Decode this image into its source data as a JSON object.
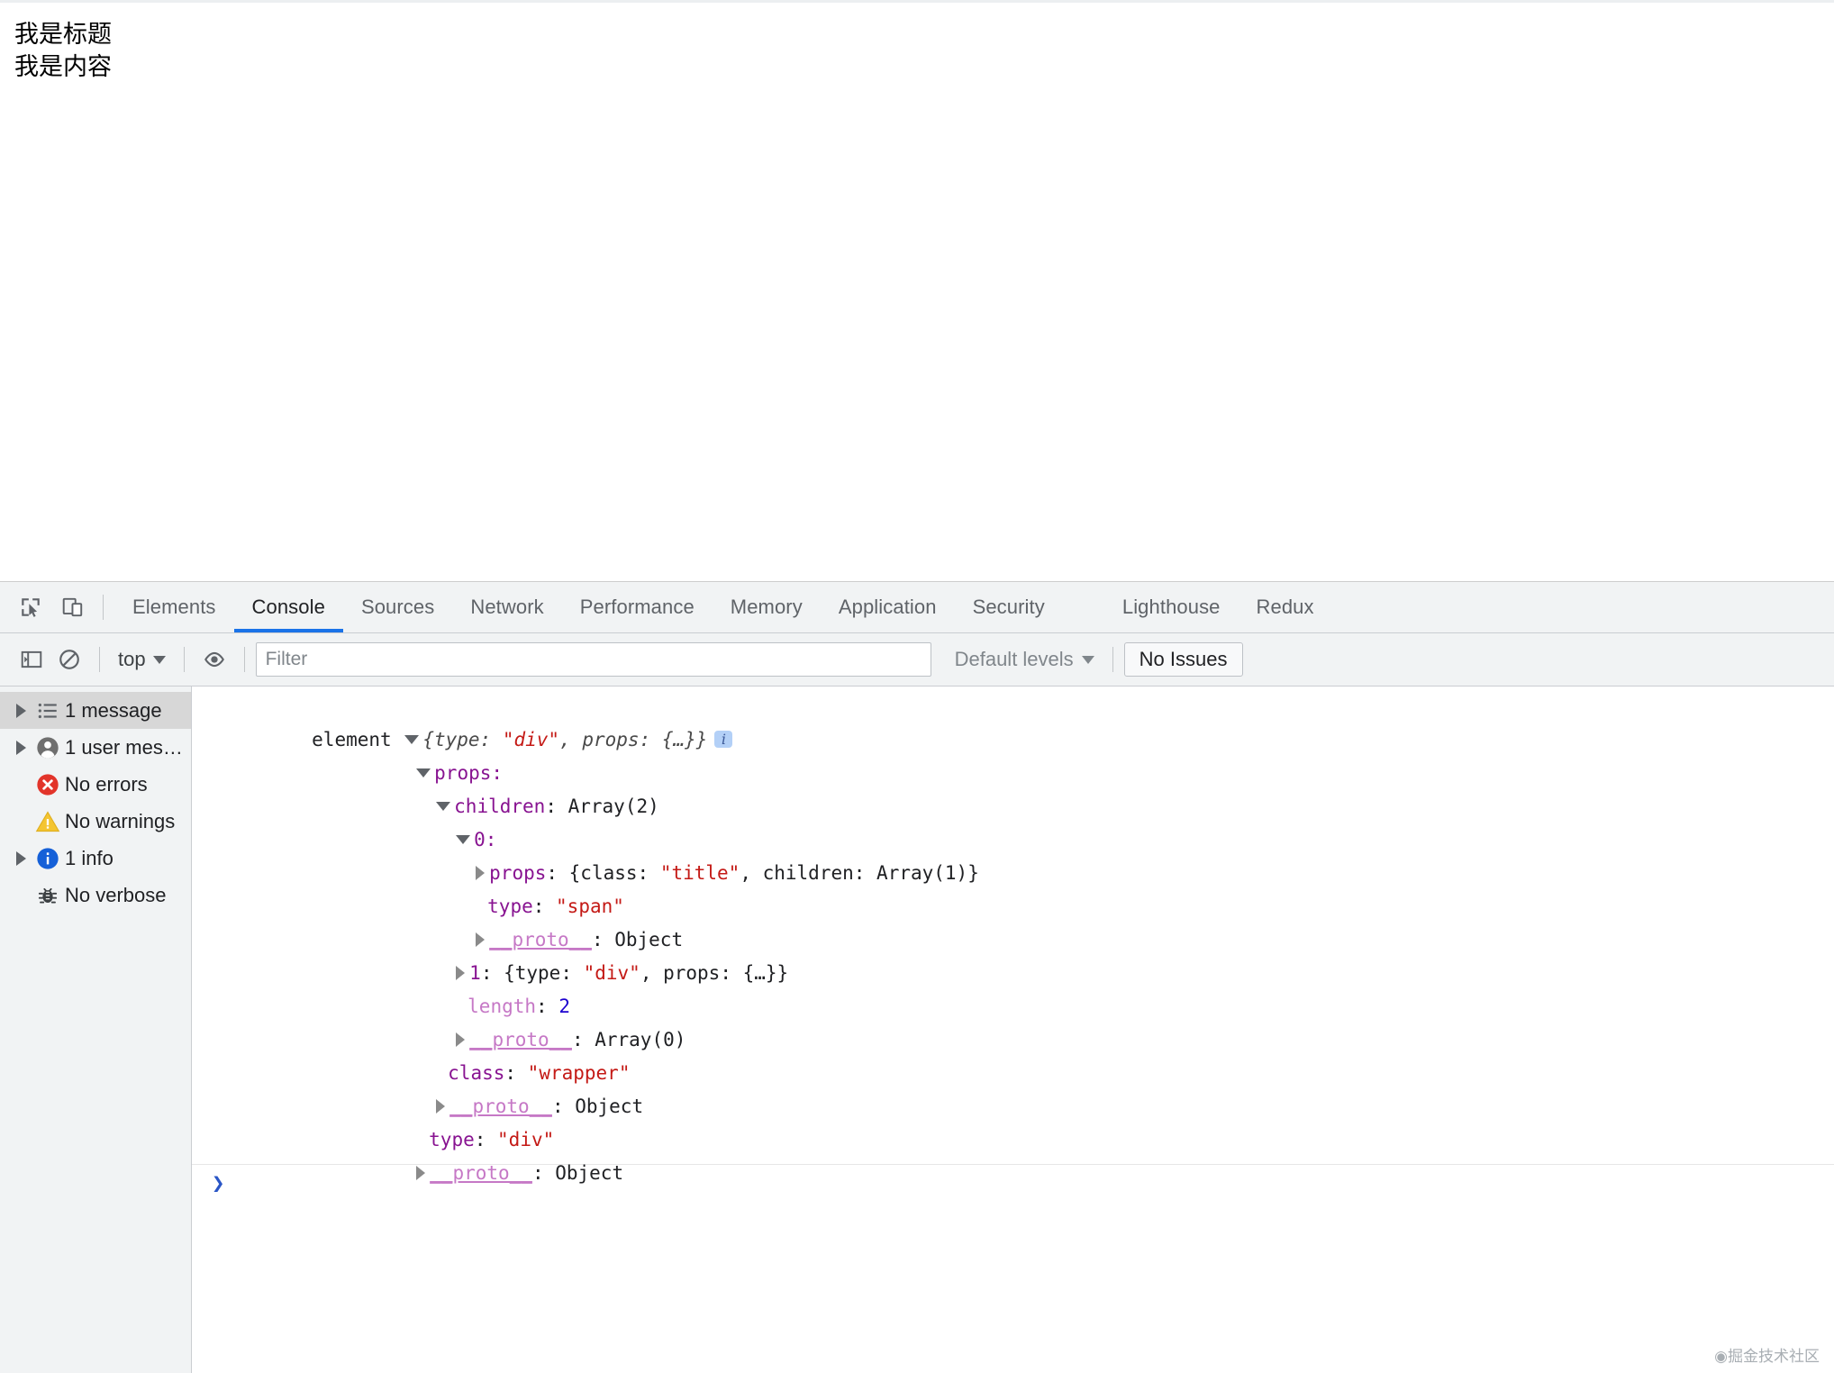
{
  "page": {
    "title_text": "我是标题",
    "content_text": "我是内容"
  },
  "devtools": {
    "toolbar_icons": {
      "inspect": "inspect-element-icon",
      "device": "device-toolbar-icon"
    },
    "tabs": [
      {
        "label": "Elements",
        "active": false
      },
      {
        "label": "Console",
        "active": true
      },
      {
        "label": "Sources",
        "active": false
      },
      {
        "label": "Network",
        "active": false
      },
      {
        "label": "Performance",
        "active": false
      },
      {
        "label": "Memory",
        "active": false
      },
      {
        "label": "Application",
        "active": false
      },
      {
        "label": "Security",
        "active": false
      },
      {
        "label": "Lighthouse",
        "active": false
      },
      {
        "label": "Redux",
        "active": false
      }
    ],
    "filterbar": {
      "sidebar_toggle_icon": "show-console-sidebar-icon",
      "clear_icon": "clear-console-icon",
      "context_value": "top",
      "eye_icon": "create-live-expression-icon",
      "filter_placeholder": "Filter",
      "filter_value": "",
      "levels_value": "Default levels",
      "issues_label": "No Issues"
    },
    "sidebar": [
      {
        "label": "1 message",
        "icon": "list-icon",
        "expandable": true,
        "selected": true
      },
      {
        "label": "1 user mes…",
        "icon": "user-icon",
        "expandable": true,
        "selected": false
      },
      {
        "label": "No errors",
        "icon": "error-icon",
        "expandable": false,
        "selected": false
      },
      {
        "label": "No warnings",
        "icon": "warning-icon",
        "expandable": false,
        "selected": false
      },
      {
        "label": "1 info",
        "icon": "info-icon",
        "expandable": true,
        "selected": false
      },
      {
        "label": "No verbose",
        "icon": "bug-icon",
        "expandable": false,
        "selected": false
      }
    ],
    "console": {
      "entry_label": "element",
      "entry_preview_open": "{",
      "entry_preview": "type: \"div\", props: {…}",
      "entry_preview_close": "}",
      "info_badge": "i",
      "lines": {
        "props": "props:",
        "children": "children: Array(2)",
        "index0": "0:",
        "props_title": "props: {class: \"title\", children: Array(1)}",
        "type_span": "type: \"span\"",
        "proto_object_1": "__proto__: Object",
        "index1": "1: {type: \"div\", props: {…}}",
        "length": "length: 2",
        "proto_array0": "__proto__: Array(0)",
        "class_wrapper": "class: \"wrapper\"",
        "proto_object_2": "__proto__: Object",
        "type_div": "type: \"div\"",
        "proto_object_3": "__proto__: Object"
      },
      "prompt_caret": "❯"
    },
    "watermark": "◉掘金技术社区",
    "colors": {
      "accent": "#1a73e8",
      "string": "#c41a16",
      "key": "#881391",
      "number": "#1c00cf",
      "error": "#e2342a",
      "warning": "#f2c230",
      "info": "#1a73e8",
      "toolbar_bg": "#f1f3f4",
      "sidebar_selected": "#d7d7d7"
    }
  }
}
